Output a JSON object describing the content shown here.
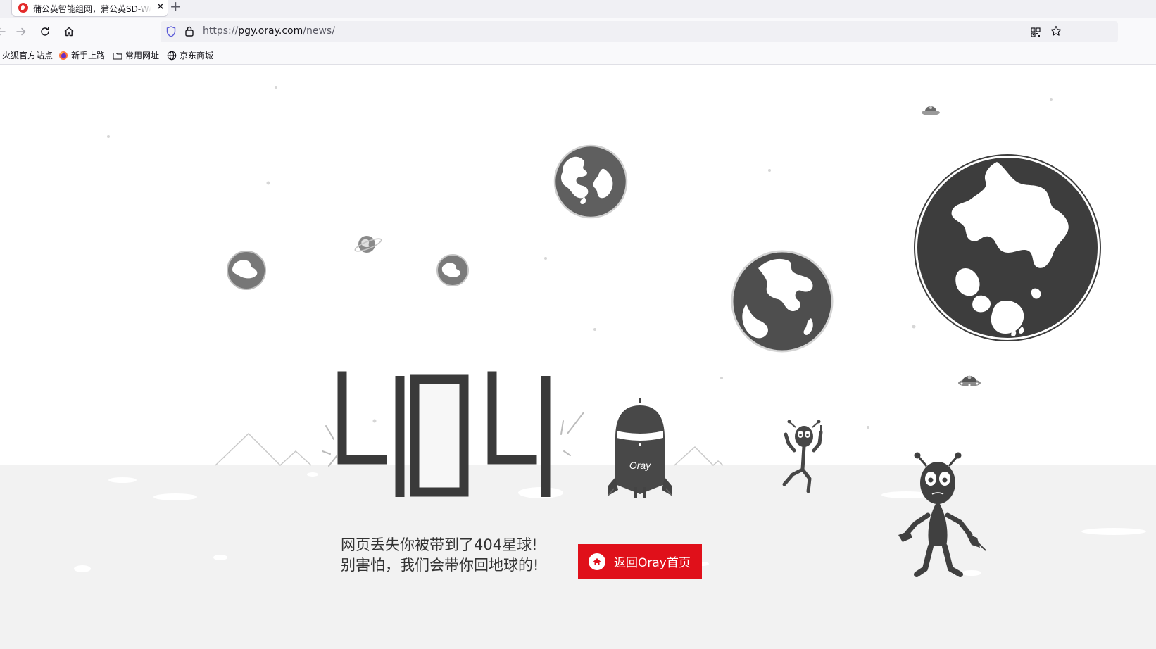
{
  "browser": {
    "tab": {
      "title": "蒲公英智能组网，蒲公英SD-WAN"
    },
    "url": {
      "scheme": "https://",
      "host": "pgy.oray.com",
      "path": "/news/"
    },
    "bookmarks": [
      {
        "label": "火狐官方站点",
        "icon": "firefox-site-icon"
      },
      {
        "label": "新手上路",
        "icon": "firefox-icon"
      },
      {
        "label": "常用网址",
        "icon": "folder-icon"
      },
      {
        "label": "京东商城",
        "icon": "globe-icon"
      }
    ]
  },
  "page": {
    "error_code": "404",
    "message_line1": "网页丢失你被带到了404星球!",
    "message_line2": "别害怕，我们会带你回地球的!",
    "home_button_label": "返回Oray首页",
    "rocket_brand": "Oray",
    "colors": {
      "accent": "#e0101a",
      "illustration": "#3c3c3c",
      "ground": "#f2f2f2"
    }
  }
}
